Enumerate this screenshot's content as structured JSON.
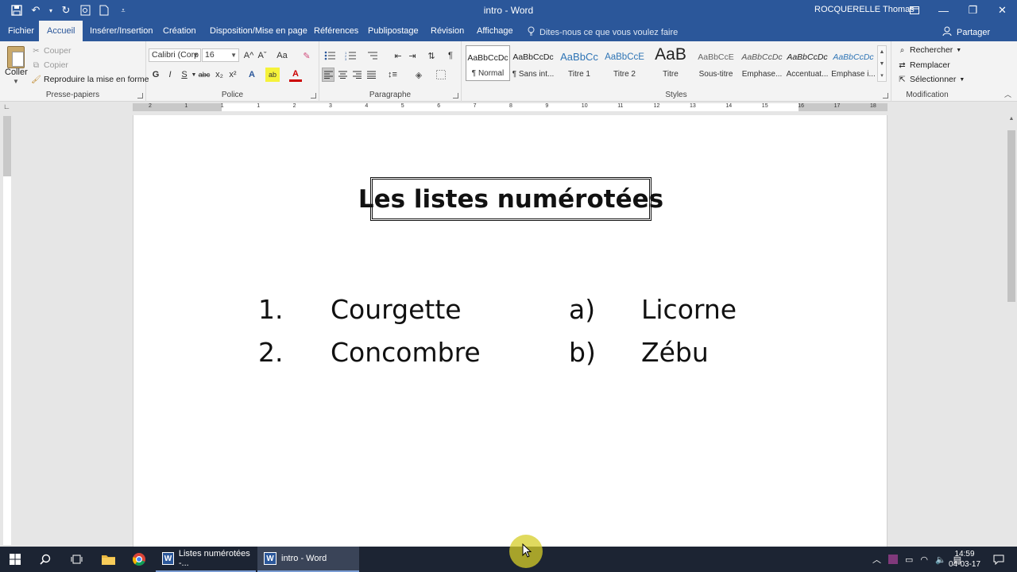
{
  "window": {
    "title": "intro - Word",
    "user": "ROCQUERELLE Thomas"
  },
  "tabs": [
    "Fichier",
    "Accueil",
    "Insérer/Insertion",
    "Création",
    "Disposition/Mise en page",
    "Références",
    "Publipostage",
    "Révision",
    "Affichage"
  ],
  "active_tab": "Accueil",
  "tell_me": "Dites-nous ce que vous voulez faire",
  "share_label": "Partager",
  "clipboard": {
    "paste": "Coller",
    "cut": "Couper",
    "copy": "Copier",
    "format_painter": "Reproduire la mise en forme",
    "label": "Presse-papiers"
  },
  "font": {
    "name": "Calibri (Corp",
    "size": "16",
    "label": "Police",
    "bold": "G",
    "italic": "I",
    "underline": "S",
    "strikethrough": "abc",
    "subscript": "x₂",
    "superscript": "x²",
    "grow": "A^",
    "shrink": "Aˇ",
    "case": "Aa",
    "effects": "A",
    "highlight": "ab",
    "color": "A"
  },
  "paragraph": {
    "label": "Paragraphe",
    "show_marks": "¶"
  },
  "styles": {
    "label": "Styles",
    "items": [
      {
        "sample": "AaBbCcDc",
        "name": "¶ Normal"
      },
      {
        "sample": "AaBbCcDc",
        "name": "¶ Sans int..."
      },
      {
        "sample": "AaBbCc",
        "name": "Titre 1"
      },
      {
        "sample": "AaBbCcE",
        "name": "Titre 2"
      },
      {
        "sample": "AaB",
        "name": "Titre"
      },
      {
        "sample": "AaBbCcE",
        "name": "Sous-titre"
      },
      {
        "sample": "AaBbCcDc",
        "name": "Emphase..."
      },
      {
        "sample": "AaBbCcDc",
        "name": "Accentuat..."
      },
      {
        "sample": "AaBbCcDc",
        "name": "Emphase i..."
      }
    ]
  },
  "editing": {
    "label": "Modification",
    "find": "Rechercher",
    "replace": "Remplacer",
    "select": "Sélectionner"
  },
  "ruler": {
    "numbers": [
      "2",
      "1",
      "1",
      "1",
      "2",
      "3",
      "4",
      "5",
      "6",
      "7",
      "8",
      "9",
      "10",
      "11",
      "12",
      "13",
      "14",
      "15",
      "16",
      "17",
      "18"
    ]
  },
  "document": {
    "title": "Les listes numérotées",
    "list_numbered": [
      {
        "marker": "1.",
        "text": "Courgette"
      },
      {
        "marker": "2.",
        "text": "Concombre"
      }
    ],
    "list_lettered": [
      {
        "marker": "a)",
        "text": "Licorne"
      },
      {
        "marker": "b)",
        "text": "Zébu"
      }
    ]
  },
  "taskbar": {
    "apps": [
      {
        "label": "Listes numérotées -..."
      },
      {
        "label": "intro - Word"
      }
    ],
    "time": "14:59",
    "date": "04-03-17"
  },
  "colors": {
    "word_blue": "#2b579a",
    "ribbon_bg": "#f3f3f3",
    "taskbar": "#1c2433"
  }
}
